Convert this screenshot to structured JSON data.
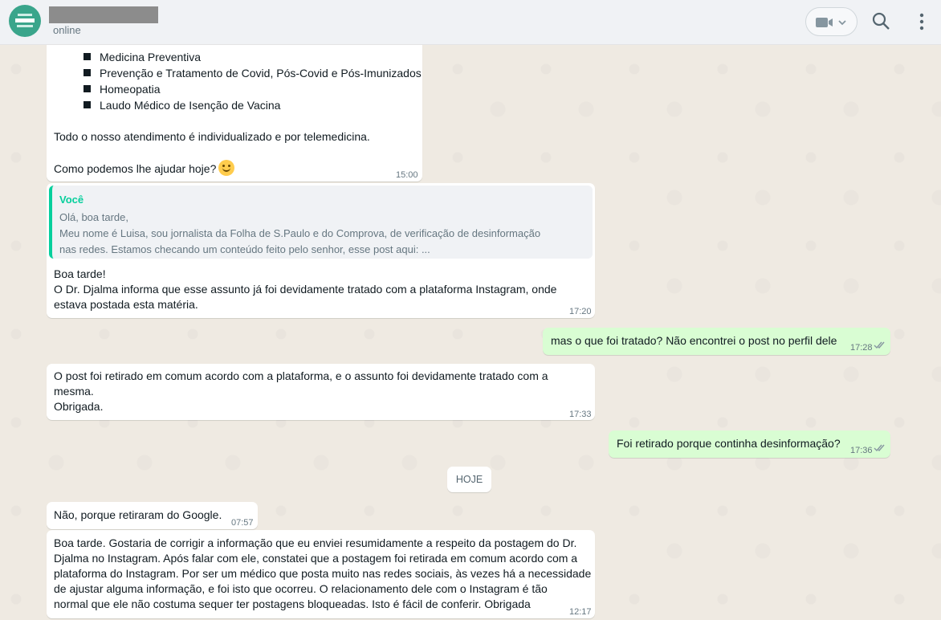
{
  "header": {
    "status": "online",
    "icons": [
      "video-camera-icon",
      "chevron-down-icon",
      "search-icon",
      "menu-dots-icon"
    ]
  },
  "messages": {
    "m1": {
      "list": [
        "Medicina Preventiva",
        "Prevenção e Tratamento de Covid, Pós-Covid e Pós-Imunizados",
        "Homeopatia",
        "Laudo Médico de Isenção de Vacina"
      ],
      "line1": "Todo o nosso atendimento é individualizado e por telemedicina.",
      "line2": "Como podemos lhe ajudar hoje?",
      "time": "15:00"
    },
    "m2": {
      "quote_author": "Você",
      "quote_lines": [
        "Olá, boa tarde,",
        "Meu nome é Luisa, sou jornalista da Folha de S.Paulo e do Comprova, de verificação de desinformação",
        "nas redes. Estamos checando um conteúdo feito pelo senhor, esse post aqui: ..."
      ],
      "lines": [
        "Boa tarde!",
        "O Dr. Djalma informa que  esse assunto já foi devidamente tratado com a plataforma Instagram, onde",
        "estava postada esta matéria."
      ],
      "time": "17:20"
    },
    "m3": {
      "text": "mas o que foi tratado? Não encontrei o post no perfil dele",
      "time": "17:28"
    },
    "m4": {
      "lines": [
        "O post foi retirado em comum acordo com a plataforma, e o assunto foi devidamente tratado com a",
        "mesma.",
        "Obrigada."
      ],
      "time": "17:33"
    },
    "m5": {
      "text": "Foi retirado porque continha desinformação?",
      "time": "17:36"
    },
    "date_chip": "HOJE",
    "m6": {
      "text": "Não, porque retiraram do Google.",
      "time": "07:57"
    },
    "m7": {
      "lines": [
        "Boa tarde. Gostaria de corrigir a informação que eu enviei resumidamente a respeito da postagem do Dr.",
        "Djalma no Instagram. Após falar com ele, constatei que a postagem foi retirada em comum acordo com a",
        "plataforma do Instagram. Por ser um médico que posta muito nas redes sociais, às vezes há a necessidade",
        "de ajustar alguma informação, e foi isto que ocorreu. O relacionamento dele com o Instagram é tão",
        "normal que ele não costuma sequer ter postagens bloqueadas. Isto é fácil de conferir. Obrigada"
      ],
      "time": "12:17"
    }
  },
  "colors": {
    "outgoing": "#d9fdd3",
    "incoming": "#ffffff",
    "accent": "#06cf9c",
    "background": "#efeae2"
  }
}
